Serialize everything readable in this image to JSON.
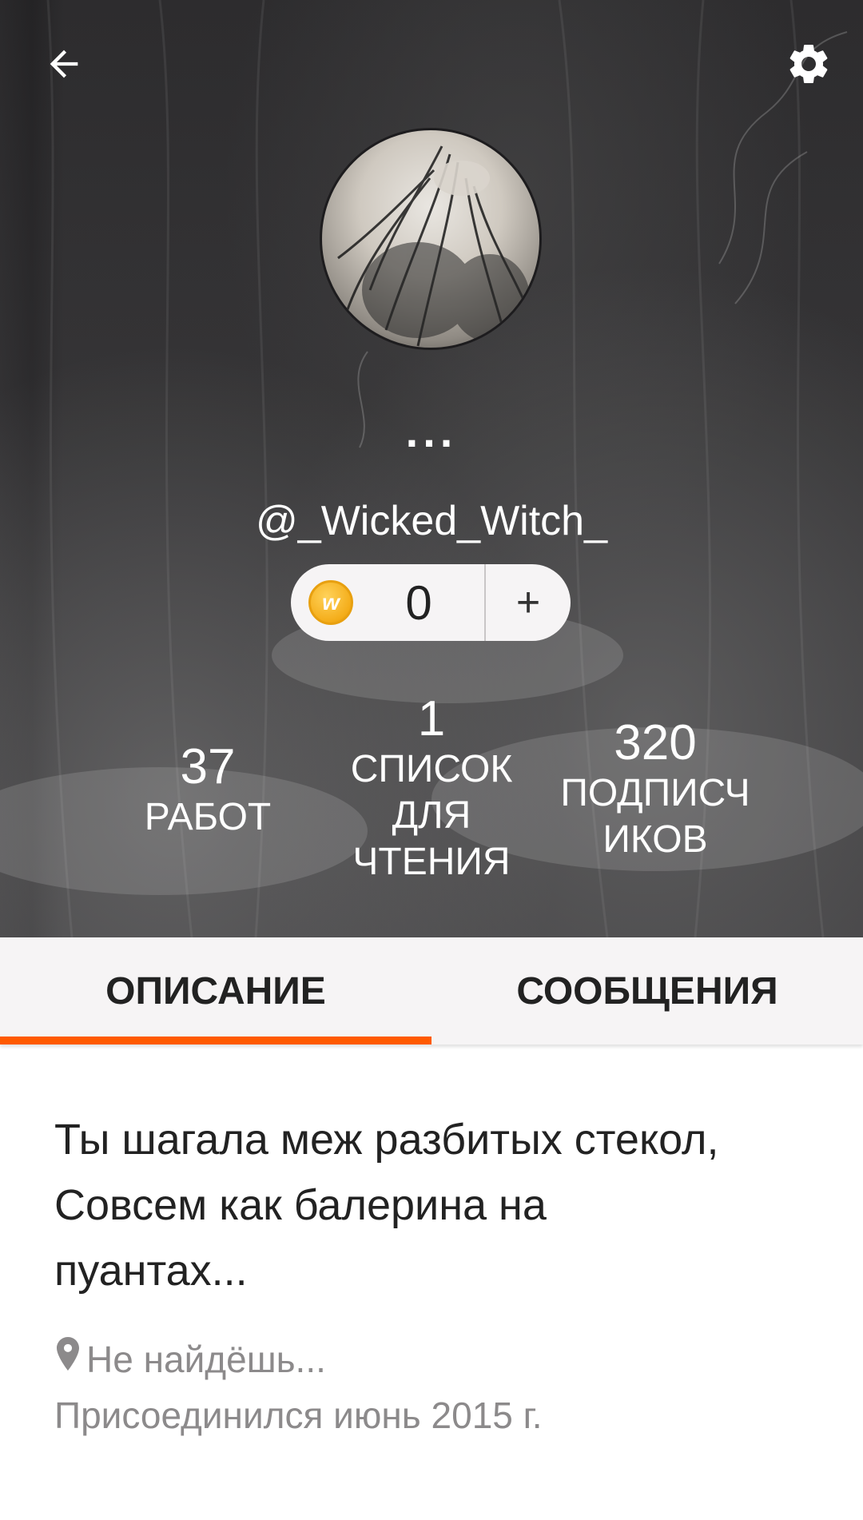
{
  "header": {
    "back_icon": "arrow-left-icon",
    "settings_icon": "gear-icon",
    "display_name": "...",
    "username": "@_Wicked_Witch_",
    "coins": {
      "icon": "wattpad-coin-icon",
      "coin_letter": "w",
      "count": "0",
      "add_label": "+"
    },
    "stats": [
      {
        "value": "37",
        "label": "РАБОТ"
      },
      {
        "value": "1",
        "label_lines": [
          "СПИСОК",
          "ДЛЯ",
          "ЧТЕНИЯ"
        ]
      },
      {
        "value": "320",
        "label_lines": [
          "ПОДПИСЧ",
          "ИКОВ"
        ]
      }
    ]
  },
  "tabs": [
    {
      "label": "ОПИСАНИЕ",
      "active": true
    },
    {
      "label": "СООБЩЕНИЯ",
      "active": false
    }
  ],
  "about": {
    "bio_lines": [
      "Ты шагала меж разбитых стекол,",
      "Совсем как балерина на",
      "пуантах..."
    ],
    "location_icon": "map-pin-icon",
    "location": "Не найдёшь...",
    "joined": "Присоединился июнь 2015 г."
  },
  "colors": {
    "accent": "#ff5a00",
    "header_bg": "#2b2a2c",
    "tab_bg": "#f6f4f5",
    "muted_text": "#8c8a8b"
  }
}
